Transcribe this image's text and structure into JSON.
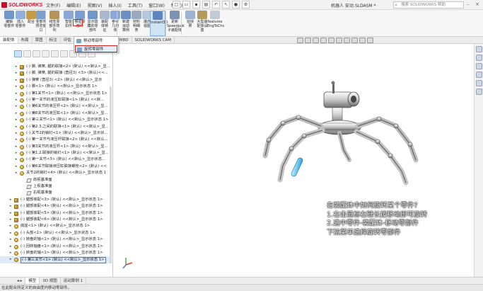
{
  "app": {
    "brand": "SOLIDWORKS",
    "doc_title": "机器人 安动.SLDASM *",
    "search_placeholder": "搜索 SOLIDWORKS 帮助"
  },
  "menu": [
    "文件(F)",
    "编辑(E)",
    "视图(V)",
    "插入(I)",
    "工具(T)",
    "窗口(W)",
    "帮助(H)"
  ],
  "ribbon": [
    {
      "label": "编辑\n零部件",
      "color": "#6f95c9"
    },
    {
      "label": "插入\n零部件",
      "color": "#8fb0dc"
    },
    {
      "label": "配合",
      "color": "#c79a45"
    },
    {
      "label": "零部件\n预览窗\n口",
      "color": "#7a9fd1"
    },
    {
      "label": "线性零\n部件阵\n列",
      "color": "#b49356"
    },
    {
      "label": "智能\n扣件",
      "color": "#8aa7d8"
    },
    {
      "label": "移动零\n部件",
      "color": "#7a9fd1"
    },
    {
      "label": "显示隐\n藏的零\n部件",
      "color": "#6f95c9"
    },
    {
      "label": "装配\n体特\n征",
      "color": "#a9b8cc"
    },
    {
      "label": "参考\n几何\n体",
      "color": "#8aa7d8"
    },
    {
      "label": "新建\n运动\n算例",
      "color": "#6a8fc4"
    },
    {
      "label": "材料\n明细\n表",
      "color": "#9aa9bd"
    },
    {
      "label": "爆炸\n视图",
      "color": "#b6c7dd"
    },
    {
      "label": "Instant3D",
      "color": "#5f85bf"
    },
    {
      "label": "更新\nSpeedpak\n子装配体",
      "color": "#7d92b3"
    },
    {
      "label": "拍快\n照",
      "color": "#9db3cf"
    },
    {
      "label": "大型装\n配体设\n置",
      "color": "#b59a5d"
    },
    {
      "label": "features\nEngToChs",
      "color": "#c3c9d3"
    }
  ],
  "cmd_tabs": [
    "装配体",
    "布局",
    "草图",
    "标注",
    "评估",
    "SOLIDWORKS 插件",
    "MBD",
    "SOLIDWORKS CAM"
  ],
  "dropdown": {
    "items": [
      "移动零部件",
      "旋转零部件"
    ]
  },
  "tree": [
    {
      "indent": 0,
      "label": "(-) 脚, 弹簧, 腿的联接<2> (默认) <<默认>_显...",
      "icon": "asm"
    },
    {
      "indent": 0,
      "label": "(-) 脚, 弹簧, 腿的联接 (直径3) <3> (默认)<<...",
      "icon": "asm"
    },
    {
      "indent": 0,
      "label": "(-) 弹簧 (直径3) <2> (默认) <<默认>_显示",
      "icon": "asm"
    },
    {
      "indent": 0,
      "label": "(-) 脚<1> (默认) <<默认>_显示状态 1>",
      "icon": "part"
    },
    {
      "indent": 0,
      "label": "(-) 第1关节<1> (默认) <<默认>_显示状态 1>",
      "icon": "part"
    },
    {
      "indent": 0,
      "label": "(-) 第一关节的液压缸联接<1> (默认) <<默...",
      "icon": "part"
    },
    {
      "indent": 0,
      "label": "(-) 第6关节的液压杆<2> (默认) <<默认>_显...",
      "icon": "part"
    },
    {
      "indent": 0,
      "label": "(-) 第6关节的液压缸<1> (默认) <<默认>_显...",
      "icon": "part"
    },
    {
      "indent": 0,
      "label": "(-) 第三关节<1> (默认) <<默认>_显示状态 1>",
      "icon": "part"
    },
    {
      "indent": 0,
      "label": "(-) 第2,3,之间的联接<1> (默认) <<默认>_显...",
      "icon": "part"
    },
    {
      "indent": 0,
      "label": "(-) 关节2的销钉<1> (默认) <<默认>_显示状...",
      "icon": "part"
    },
    {
      "indent": 0,
      "label": "(-) 第一关节与液压杆联接<2> (默认) <<默认...",
      "icon": "part"
    },
    {
      "indent": 0,
      "label": "(-) 第3关节的液压杆<1> (默认) <<默认>_显...",
      "icon": "part"
    },
    {
      "indent": 0,
      "label": "(-) 第1,2,联接的销钉<1> (默认) <<默认>_显...",
      "icon": "part"
    },
    {
      "indent": 0,
      "label": "(-) 第一关节<3> (默认) <<默认>_显示状态...",
      "icon": "part"
    },
    {
      "indent": 0,
      "label": "(-) 第6关节联接液压缸联接螺栓<2> (默认) <<",
      "icon": "part"
    },
    {
      "indent": 0,
      "label": "关节2的销钉<4> (默认) <<默认>_显示状态 1",
      "icon": "part"
    },
    {
      "indent": 1,
      "label": "前视基准面",
      "icon": "plane"
    },
    {
      "indent": 1,
      "label": "上视基准面",
      "icon": "plane"
    },
    {
      "indent": 1,
      "label": "右视基准面",
      "icon": "plane"
    },
    {
      "indent": -1,
      "label": "(-) 腿部装配<3> (默认) <<默认>_显示状态 1>",
      "icon": "asm"
    },
    {
      "indent": -1,
      "label": "(-) 腿部装配<4> (默认) <<默认>_显示状态 1>",
      "icon": "asm"
    },
    {
      "indent": -1,
      "label": "(-) 腿部装配<5> (默认) <<默认>_显示状态 1>",
      "icon": "asm"
    },
    {
      "indent": -1,
      "label": "(-) 腿部装配<6> (默认) <<默认>_显示状态 1>",
      "icon": "asm"
    },
    {
      "indent": -1,
      "label": "底座<1> (默认) <<默认>_显示状态 1>",
      "icon": "part"
    },
    {
      "indent": -1,
      "label": "(-) 头部<1> (默认) <<默认>_显示状态 1>",
      "icon": "part"
    },
    {
      "indent": -1,
      "label": "(-) 转盘的轴<1> (默认) <<默认>_显示状态 1>",
      "icon": "part"
    },
    {
      "indent": -1,
      "label": "(-) 回转轴盘<1> (默认) <<默认>_显示状态 1>",
      "icon": "part"
    },
    {
      "indent": -1,
      "label": "(-) 转盘的轴<1> (默认) <<默认>_显示状态 1>",
      "icon": "part"
    },
    {
      "indent": -1,
      "label": "(-) 第三关节<1> (默认) <<默认>_显示状态 1>",
      "icon": "part",
      "selected": true
    }
  ],
  "bottom_tabs": [
    "模型",
    "3D 视图",
    "运动算例 1"
  ],
  "status": "在此配合所定义的自由度内移动零部件。",
  "annotation": [
    "在装配体中如何旋转某个零件?",
    "1.右击鼠标右键长按移动即可旋转",
    "2.选中零件-装配体-移动零部件",
    "下拉菜单选择旋转零部件"
  ],
  "colors": {
    "accent_red": "#d9201b",
    "selection_blue": "#3f7ad0"
  }
}
